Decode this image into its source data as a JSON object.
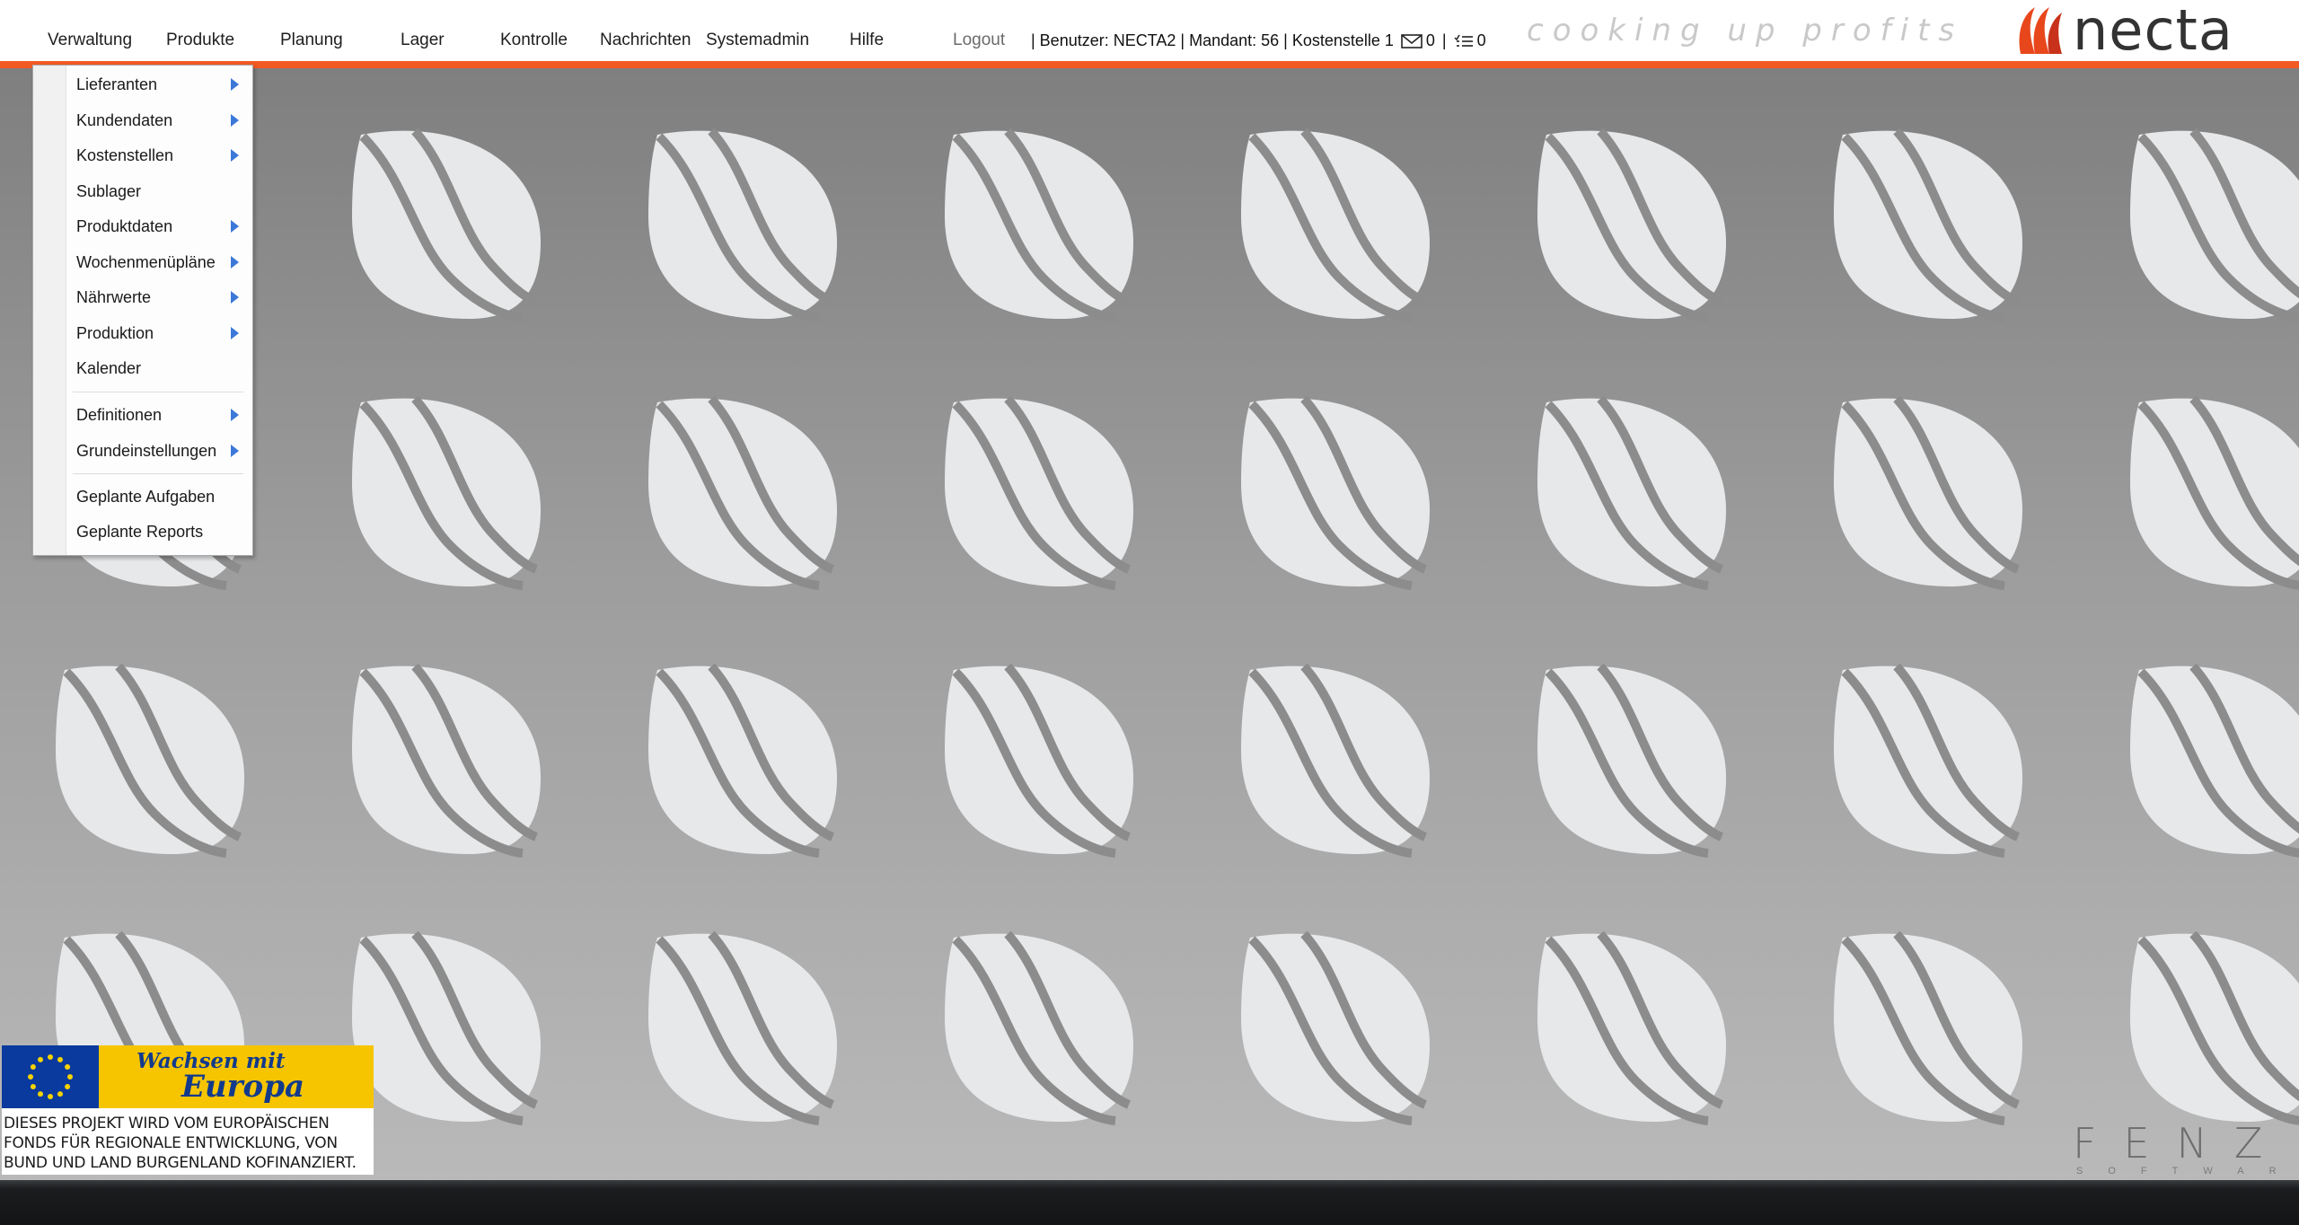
{
  "menu_bar": {
    "items": [
      {
        "label": "Verwaltung"
      },
      {
        "label": "Produkte"
      },
      {
        "label": "Planung"
      },
      {
        "label": "Lager"
      },
      {
        "label": "Kontrolle"
      },
      {
        "label": "Nachrichten"
      },
      {
        "label": "Systemadmin"
      },
      {
        "label": "Hilfe"
      }
    ],
    "logout_label": "Logout"
  },
  "status": {
    "user_info": "| Benutzer: NECTA2 | Mandant: 56 | Kostenstelle 1",
    "message_count": "0",
    "separator": "|",
    "task_count": "0"
  },
  "branding": {
    "tagline": "cooking up profits",
    "logo_text": "necta",
    "brand_color": "#f15a22"
  },
  "dropdown": {
    "open_menu": "Verwaltung",
    "items": [
      {
        "label": "Lieferanten",
        "has_submenu": true
      },
      {
        "label": "Kundendaten",
        "has_submenu": true
      },
      {
        "label": "Kostenstellen",
        "has_submenu": true
      },
      {
        "label": "Sublager",
        "has_submenu": false
      },
      {
        "label": "Produktdaten",
        "has_submenu": true
      },
      {
        "label": "Wochenmenüpläne",
        "has_submenu": true
      },
      {
        "label": "Nährwerte",
        "has_submenu": true
      },
      {
        "label": "Produktion",
        "has_submenu": true
      },
      {
        "label": "Kalender",
        "has_submenu": false
      },
      {
        "label": "Definitionen",
        "has_submenu": true
      },
      {
        "label": "Grundeinstellungen",
        "has_submenu": true
      },
      {
        "label": "Geplante Aufgaben",
        "has_submenu": false
      },
      {
        "label": "Geplante Reports",
        "has_submenu": false
      }
    ]
  },
  "eu_banner": {
    "slogan_line1": "Wachsen mit",
    "slogan_line2": "Europa",
    "text_line1": "DIESES PROJEKT WIRD VOM EUROPÄISCHEN",
    "text_line2": "FONDS FÜR REGIONALE ENTWICKLUNG, VON",
    "text_line3": "BUND UND LAND BURGENLAND KOFINANZIERT."
  },
  "footer_logo": {
    "name": "FENZ",
    "subtitle": "SOFTWARE"
  },
  "icons": {
    "messages": "envelope-icon",
    "tasks": "task-list-icon",
    "submenu": "triangle-right-icon"
  }
}
